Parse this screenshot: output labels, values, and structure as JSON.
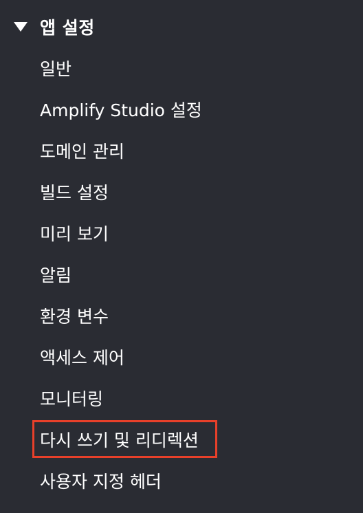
{
  "section": {
    "title": "앱 설정",
    "icon": "caret-down-icon"
  },
  "nav": {
    "items": [
      {
        "label": "일반"
      },
      {
        "label": "Amplify Studio 설정"
      },
      {
        "label": "도메인 관리"
      },
      {
        "label": "빌드 설정"
      },
      {
        "label": "미리 보기"
      },
      {
        "label": "알림"
      },
      {
        "label": "환경 변수"
      },
      {
        "label": "액세스 제어"
      },
      {
        "label": "모니터링"
      },
      {
        "label": "다시 쓰기 및 리디렉션",
        "highlighted": true
      },
      {
        "label": "사용자 지정 헤더"
      }
    ]
  },
  "colors": {
    "background": "#2a2c33",
    "text": "#ffffff",
    "highlight_border": "#e8402a"
  }
}
